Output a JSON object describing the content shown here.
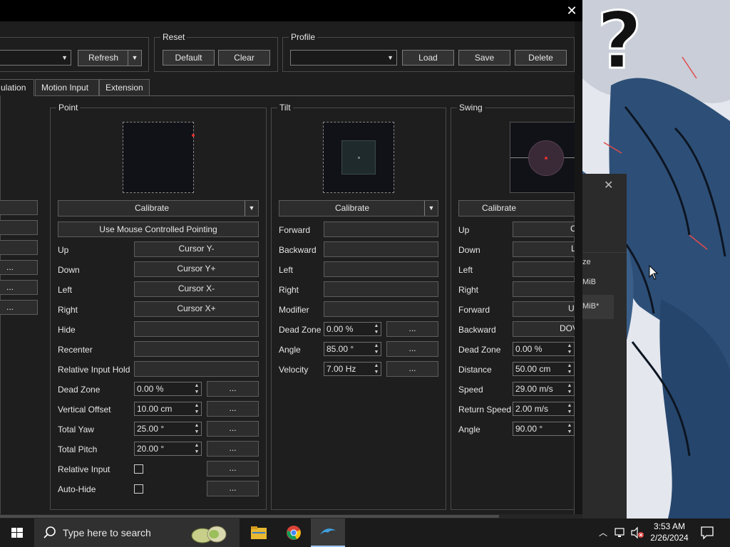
{
  "colors": {
    "accent": "#9fc7ff",
    "window_bg": "#1e1e1e",
    "titlebar": "#000000",
    "taskbar": "#1b1b1b"
  },
  "window": {
    "close_icon": "close-icon"
  },
  "top": {
    "refresh_label": "Refresh",
    "reset": {
      "title": "Reset",
      "default_label": "Default",
      "clear_label": "Clear"
    },
    "profile": {
      "title": "Profile",
      "load_label": "Load",
      "save_label": "Save",
      "delete_label": "Delete"
    }
  },
  "tabs": [
    {
      "label": "ulation"
    },
    {
      "label": "Motion Input"
    },
    {
      "label": "Extension"
    }
  ],
  "left_partial": {
    "dots": [
      "...",
      "...",
      "..."
    ]
  },
  "point": {
    "title": "Point",
    "calibrate_label": "Calibrate",
    "mouse_pointing_label": "Use Mouse Controlled Pointing",
    "rows": [
      {
        "label": "Up",
        "value": "Cursor Y-"
      },
      {
        "label": "Down",
        "value": "Cursor Y+"
      },
      {
        "label": "Left",
        "value": "Cursor X-"
      },
      {
        "label": "Right",
        "value": "Cursor X+"
      },
      {
        "label": "Hide",
        "value": ""
      },
      {
        "label": "Recenter",
        "value": ""
      },
      {
        "label": "Relative Input Hold",
        "value": ""
      }
    ],
    "settings": [
      {
        "label": "Dead Zone",
        "value": "0.00 %",
        "more": "..."
      },
      {
        "label": "Vertical Offset",
        "value": "10.00 cm",
        "more": "..."
      },
      {
        "label": "Total Yaw",
        "value": "25.00 °",
        "more": "..."
      },
      {
        "label": "Total Pitch",
        "value": "20.00 °",
        "more": "..."
      }
    ],
    "checks": [
      {
        "label": "Relative Input",
        "more": "..."
      },
      {
        "label": "Auto-Hide",
        "more": "..."
      }
    ]
  },
  "tilt": {
    "title": "Tilt",
    "calibrate_label": "Calibrate",
    "rows": [
      {
        "label": "Forward"
      },
      {
        "label": "Backward"
      },
      {
        "label": "Left"
      },
      {
        "label": "Right"
      },
      {
        "label": "Modifier"
      }
    ],
    "settings": [
      {
        "label": "Dead Zone",
        "value": "0.00 %",
        "more": "..."
      },
      {
        "label": "Angle",
        "value": "85.00 °",
        "more": "..."
      },
      {
        "label": "Velocity",
        "value": "7.00 Hz",
        "more": "..."
      }
    ]
  },
  "swing": {
    "title": "Swing",
    "calibrate_label": "Calibrate",
    "rows": [
      {
        "label": "Up",
        "value": "C"
      },
      {
        "label": "Down",
        "value": "L"
      },
      {
        "label": "Left",
        "value": ""
      },
      {
        "label": "Right",
        "value": ""
      },
      {
        "label": "Forward",
        "value": "U"
      },
      {
        "label": "Backward",
        "value": "DOV"
      }
    ],
    "settings": [
      {
        "label": "Dead Zone",
        "value": "0.00 %"
      },
      {
        "label": "Distance",
        "value": "50.00 cm"
      },
      {
        "label": "Speed",
        "value": "29.00 m/s"
      },
      {
        "label": "Return Speed",
        "value": "2.00 m/s"
      },
      {
        "label": "Angle",
        "value": "90.00 °"
      }
    ]
  },
  "bg_dialog": {
    "rows": [
      "ze",
      "MiB",
      "MiB*"
    ]
  },
  "taskbar": {
    "search_placeholder": "Type here to search",
    "time": "3:53 AM",
    "date": "2/26/2024",
    "apps": [
      "file-explorer-icon",
      "chrome-icon",
      "dolphin-icon"
    ]
  }
}
